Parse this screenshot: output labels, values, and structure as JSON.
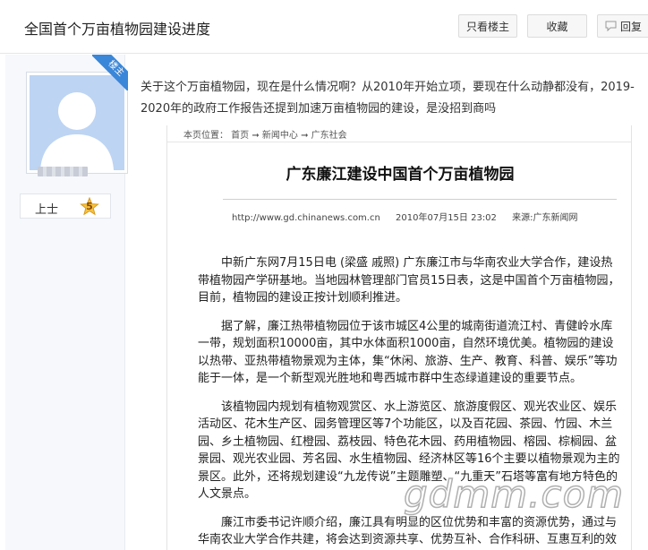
{
  "header": {
    "title": "全国首个万亩植物园建设进度",
    "buttons": {
      "only_op": "只看楼主",
      "favorite": "收藏",
      "reply": "回复"
    }
  },
  "user": {
    "badge": "楼主",
    "rank": "上士",
    "level": "5"
  },
  "post": {
    "text": "关于这个万亩植物园，现在是什么情况啊？从2010年开始立项，要现在什么动静都没有，2019-2020年的政府工作报告还提到加速万亩植物园的建设，是没招到商吗"
  },
  "news": {
    "breadcrumb": "本页位置： 首页 ➞ 新闻中心 ➞ 广东社会",
    "title": "广东廉江建设中国首个万亩植物园",
    "url": "http://www.gd.chinanews.com.cn",
    "date": "2010年07月15日 23:02",
    "source": "来源:广东新闻网",
    "paragraphs": [
      "中新广东网7月15日电  (梁盛 戚照) 广东廉江市与华南农业大学合作，建设热带植物园产学研基地。当地园林管理部门官员15日表，这是中国首个万亩植物园，目前，植物园的建设正按计划顺利推进。",
      "据了解，廉江热带植物园位于该市城区4公里的城南街道流江村、青健岭水库一带，规划面积10000亩，其中水体面积1000亩，自然环境优美。植物园的建设以热带、亚热带植物景观为主体，集“休闲、旅游、生产、教育、科普、娱乐”等功能于一体，是一个新型观光胜地和粤西城市群中生态绿道建设的重要节点。",
      "该植物园内规划有植物观赏区、水上游览区、旅游度假区、观光农业区、娱乐活动区、花木生产区、园务管理区等7个功能区，以及百花园、茶园、竹园、木兰园、乡土植物园、红橙园、荔枝园、特色花木园、药用植物园、榕园、棕榈园、盆景园、观光农业园、芳名园、水生植物园、经济林区等16个主要以植物景观为主的景区。此外，还将规划建设“九龙传说”主题雕塑、“九重天”石塔等富有地方特色的人文景点。",
      "廉江市委书记许顺介绍，廉江具有明显的区位优势和丰富的资源优势，通过与华南农业大学合作共建，将会达到资源共享、优势互补、合作科研、互惠互利的效果。"
    ],
    "watermark": "gdmm.com"
  },
  "colors": {
    "badge": "#3a86d8",
    "avatar_bg": "#bdd4f3",
    "sidebar_bg": "#f6f8fb"
  }
}
